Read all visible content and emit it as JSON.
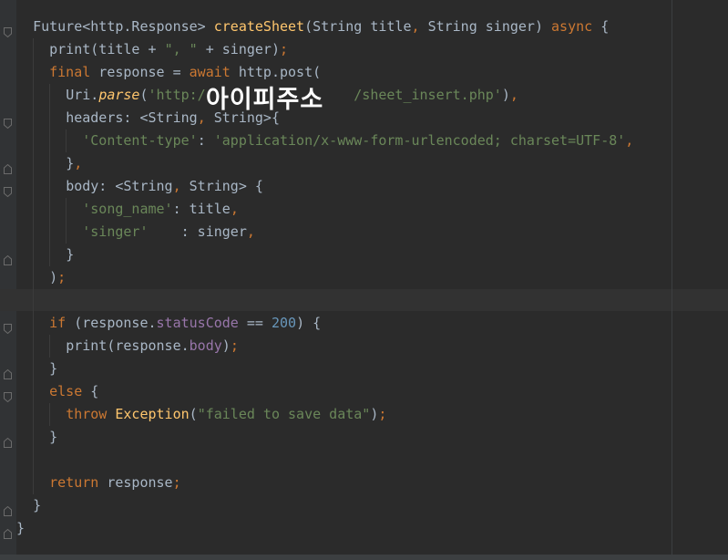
{
  "editor": {
    "lines": [
      {
        "indent": "  ",
        "fold": "open",
        "tokens": [
          {
            "t": "Future<http.Response> ",
            "c": ""
          },
          {
            "t": "createSheet",
            "c": "fn"
          },
          {
            "t": "(String title",
            "c": ""
          },
          {
            "t": ", ",
            "c": "kw"
          },
          {
            "t": "String singer) ",
            "c": ""
          },
          {
            "t": "async",
            "c": "kw"
          },
          {
            "t": " {",
            "c": ""
          }
        ]
      },
      {
        "indent": "    ",
        "fold": "",
        "tokens": [
          {
            "t": "print(title + ",
            "c": ""
          },
          {
            "t": "\", \"",
            "c": "str"
          },
          {
            "t": " + singer)",
            "c": ""
          },
          {
            "t": ";",
            "c": "kw"
          }
        ]
      },
      {
        "indent": "    ",
        "fold": "",
        "tokens": [
          {
            "t": "final",
            "c": "kw"
          },
          {
            "t": " response = ",
            "c": ""
          },
          {
            "t": "await",
            "c": "kw"
          },
          {
            "t": " http.post(",
            "c": ""
          }
        ]
      },
      {
        "indent": "      ",
        "fold": "",
        "tokens": [
          {
            "t": "Uri.",
            "c": ""
          },
          {
            "t": "parse",
            "c": "ital"
          },
          {
            "t": "(",
            "c": ""
          },
          {
            "t": "'http:/",
            "c": "str"
          },
          {
            "t": "                  ",
            "c": ""
          },
          {
            "t": "/sheet_insert.php'",
            "c": "str"
          },
          {
            "t": ")",
            "c": ""
          },
          {
            "t": ",",
            "c": "kw"
          }
        ]
      },
      {
        "indent": "      ",
        "fold": "open",
        "tokens": [
          {
            "t": "headers: <String",
            "c": ""
          },
          {
            "t": ", ",
            "c": "kw"
          },
          {
            "t": "String>{",
            "c": ""
          }
        ]
      },
      {
        "indent": "        ",
        "fold": "",
        "tokens": [
          {
            "t": "'Content-type'",
            "c": "str"
          },
          {
            "t": ": ",
            "c": ""
          },
          {
            "t": "'application/x-www-form-urlencoded; charset=UTF-8'",
            "c": "str"
          },
          {
            "t": ",",
            "c": "kw"
          }
        ]
      },
      {
        "indent": "      ",
        "fold": "close",
        "tokens": [
          {
            "t": "}",
            "c": ""
          },
          {
            "t": ",",
            "c": "kw"
          }
        ]
      },
      {
        "indent": "      ",
        "fold": "open",
        "tokens": [
          {
            "t": "body: <String",
            "c": ""
          },
          {
            "t": ", ",
            "c": "kw"
          },
          {
            "t": "String> {",
            "c": ""
          }
        ]
      },
      {
        "indent": "        ",
        "fold": "",
        "tokens": [
          {
            "t": "'song_name'",
            "c": "str"
          },
          {
            "t": ": title",
            "c": ""
          },
          {
            "t": ",",
            "c": "kw"
          }
        ]
      },
      {
        "indent": "        ",
        "fold": "",
        "tokens": [
          {
            "t": "'singer'",
            "c": "str"
          },
          {
            "t": "    : singer",
            "c": ""
          },
          {
            "t": ",",
            "c": "kw"
          }
        ]
      },
      {
        "indent": "      ",
        "fold": "close",
        "tokens": [
          {
            "t": "}",
            "c": ""
          }
        ]
      },
      {
        "indent": "    ",
        "fold": "",
        "tokens": [
          {
            "t": ")",
            "c": ""
          },
          {
            "t": ";",
            "c": "kw"
          }
        ]
      },
      {
        "indent": "",
        "fold": "",
        "tokens": []
      },
      {
        "indent": "    ",
        "fold": "open",
        "tokens": [
          {
            "t": "if",
            "c": "kw"
          },
          {
            "t": " (response.",
            "c": ""
          },
          {
            "t": "statusCode",
            "c": "fld"
          },
          {
            "t": " == ",
            "c": ""
          },
          {
            "t": "200",
            "c": "num"
          },
          {
            "t": ") {",
            "c": ""
          }
        ]
      },
      {
        "indent": "      ",
        "fold": "",
        "tokens": [
          {
            "t": "print(response.",
            "c": ""
          },
          {
            "t": "body",
            "c": "fld"
          },
          {
            "t": ")",
            "c": ""
          },
          {
            "t": ";",
            "c": "kw"
          }
        ]
      },
      {
        "indent": "    ",
        "fold": "close",
        "tokens": [
          {
            "t": "}",
            "c": ""
          }
        ]
      },
      {
        "indent": "    ",
        "fold": "open",
        "tokens": [
          {
            "t": "else",
            "c": "kw"
          },
          {
            "t": " {",
            "c": ""
          }
        ]
      },
      {
        "indent": "      ",
        "fold": "",
        "tokens": [
          {
            "t": "throw",
            "c": "kw"
          },
          {
            "t": " ",
            "c": ""
          },
          {
            "t": "Exception",
            "c": "fn"
          },
          {
            "t": "(",
            "c": ""
          },
          {
            "t": "\"failed to save data\"",
            "c": "str"
          },
          {
            "t": ")",
            "c": ""
          },
          {
            "t": ";",
            "c": "kw"
          }
        ]
      },
      {
        "indent": "    ",
        "fold": "close",
        "tokens": [
          {
            "t": "}",
            "c": ""
          }
        ]
      },
      {
        "indent": "",
        "fold": "",
        "tokens": []
      },
      {
        "indent": "    ",
        "fold": "",
        "tokens": [
          {
            "t": "return",
            "c": "kw"
          },
          {
            "t": " response",
            "c": ""
          },
          {
            "t": ";",
            "c": "kw"
          }
        ]
      },
      {
        "indent": "  ",
        "fold": "close",
        "tokens": [
          {
            "t": "}",
            "c": ""
          }
        ]
      },
      {
        "indent": "",
        "fold": "close",
        "tokens": [
          {
            "t": "}",
            "c": ""
          }
        ]
      }
    ]
  },
  "overlay": {
    "text": "아이피주소"
  },
  "colors": {
    "background": "#2b2b2b",
    "keyword": "#cc7832",
    "function": "#ffc66d",
    "string": "#6a8759",
    "number": "#6897bb",
    "field": "#9876aa",
    "default": "#a9b7c6"
  }
}
